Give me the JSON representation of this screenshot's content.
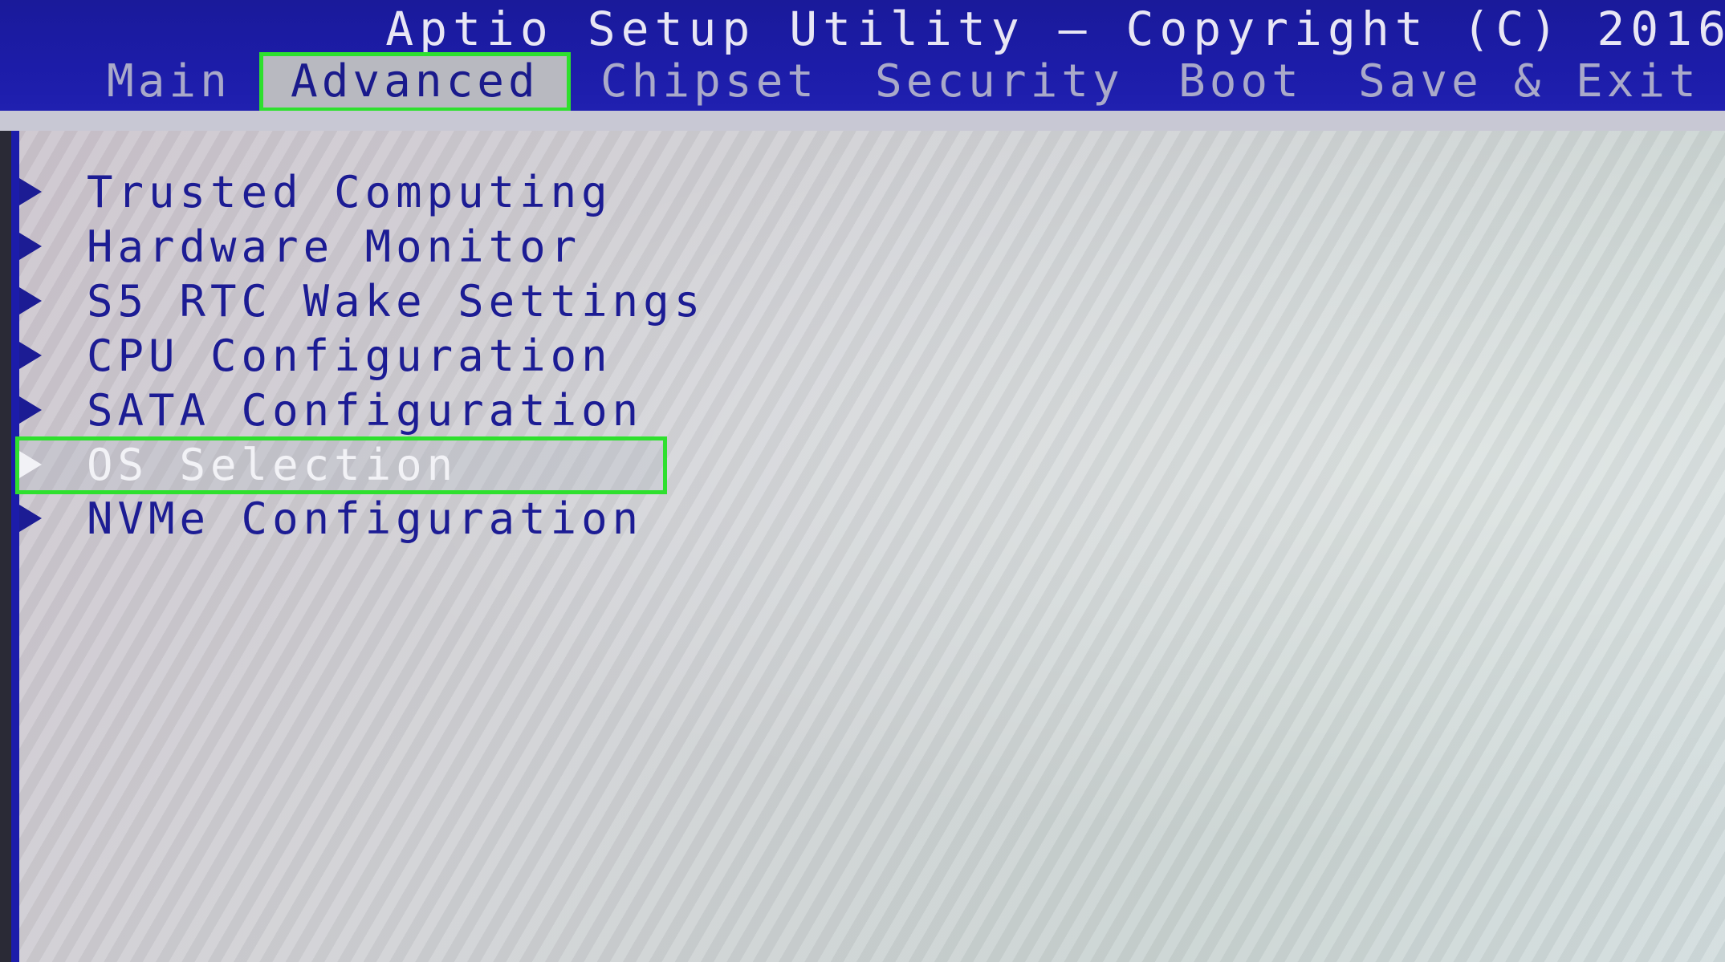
{
  "header": {
    "title": "Aptio Setup Utility – Copyright (C) 2016",
    "tabs": [
      {
        "label": "Main"
      },
      {
        "label": "Advanced",
        "active": true
      },
      {
        "label": "Chipset"
      },
      {
        "label": "Security"
      },
      {
        "label": "Boot"
      },
      {
        "label": "Save & Exit"
      }
    ]
  },
  "menu": {
    "items": [
      {
        "label": "Trusted Computing"
      },
      {
        "label": "Hardware Monitor"
      },
      {
        "label": "S5 RTC Wake Settings"
      },
      {
        "label": "CPU Configuration"
      },
      {
        "label": "SATA Configuration"
      },
      {
        "label": "OS Selection",
        "selected": true
      },
      {
        "label": "NVMe Configuration"
      }
    ],
    "arrow_icon": "triangle-right-icon"
  },
  "colors": {
    "header_bg": "#1c1ca8",
    "highlight_outline": "#2ee02e",
    "menu_text": "#1c1c94",
    "selected_text": "#f2f2f6",
    "inactive_tab_text": "#a9a9c9"
  }
}
